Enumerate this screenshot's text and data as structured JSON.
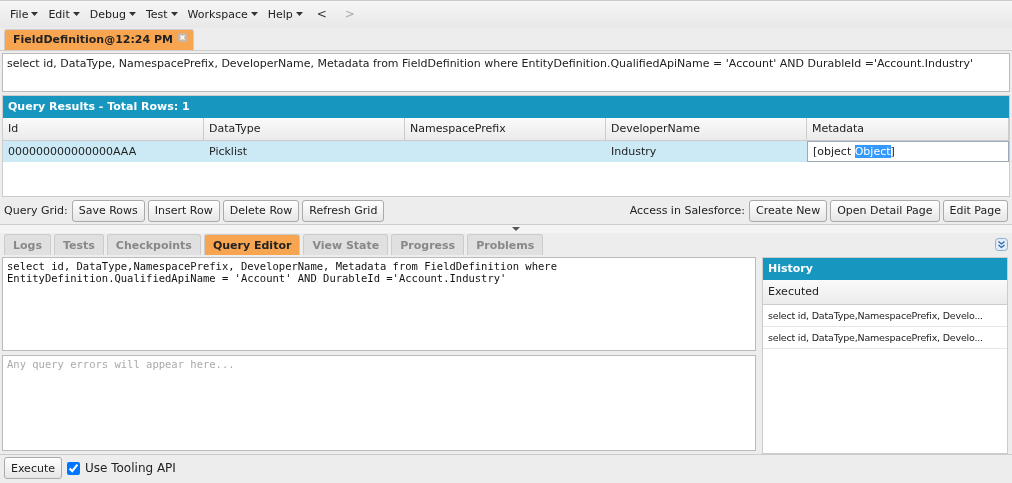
{
  "menu": [
    {
      "label": "File"
    },
    {
      "label": "Edit"
    },
    {
      "label": "Debug"
    },
    {
      "label": "Test"
    },
    {
      "label": "Workspace"
    },
    {
      "label": "Help"
    }
  ],
  "nav": [
    {
      "label": "<",
      "disabled": false
    },
    {
      "label": ">",
      "disabled": true
    }
  ],
  "document_tabs": [
    {
      "label": "FieldDefinition@12:24 PM",
      "selected": true
    }
  ],
  "query_text": "select id, DataType, NamespacePrefix, DeveloperName, Metadata from FieldDefinition where EntityDefinition.QualifiedApiName = 'Account' AND DurableId ='Account.Industry'",
  "results": {
    "title": "Query Results - Total Rows: 1",
    "columns": [
      "Id",
      "DataType",
      "NamespacePrefix",
      "DeveloperName",
      "Metadata"
    ],
    "rows": [
      {
        "selected": true,
        "cells": [
          {
            "kind": "text",
            "text": "000000000000000AAA"
          },
          {
            "kind": "text",
            "text": "Picklist"
          },
          {
            "kind": "text",
            "text": ""
          },
          {
            "kind": "text",
            "text": "Industry"
          },
          {
            "kind": "editor",
            "before": "[object ",
            "highlighted": "Object",
            "after": "]"
          }
        ]
      }
    ]
  },
  "grid_toolbar": {
    "label": "Query Grid:",
    "buttons": [
      "Save Rows",
      "Insert Row",
      "Delete Row",
      "Refresh Grid"
    ],
    "salesforce_label": "Access in Salesforce:",
    "salesforce_buttons": [
      "Create New",
      "Open Detail Page",
      "Edit Page"
    ]
  },
  "panel_tabs": [
    {
      "label": "Logs",
      "selected": false
    },
    {
      "label": "Tests",
      "selected": false
    },
    {
      "label": "Checkpoints",
      "selected": false
    },
    {
      "label": "Query Editor",
      "selected": true
    },
    {
      "label": "View State",
      "selected": false
    },
    {
      "label": "Progress",
      "selected": false
    },
    {
      "label": "Problems",
      "selected": false
    }
  ],
  "editor_lines": [
    "select id, DataType,NamespacePrefix, DeveloperName, Metadata from FieldDefinition where",
    "EntityDefinition.QualifiedApiName = 'Account' AND DurableId ='Account.Industry'"
  ],
  "errors_placeholder": "Any query errors will appear here...",
  "history": {
    "title": "History",
    "column": "Executed",
    "items": [
      "select id, DataType,NamespacePrefix, Develo...",
      "select id, DataType,NamespacePrefix, Develo..."
    ]
  },
  "execute_button": "Execute",
  "use_tooling_api": {
    "label": "Use Tooling API",
    "checked": true
  }
}
